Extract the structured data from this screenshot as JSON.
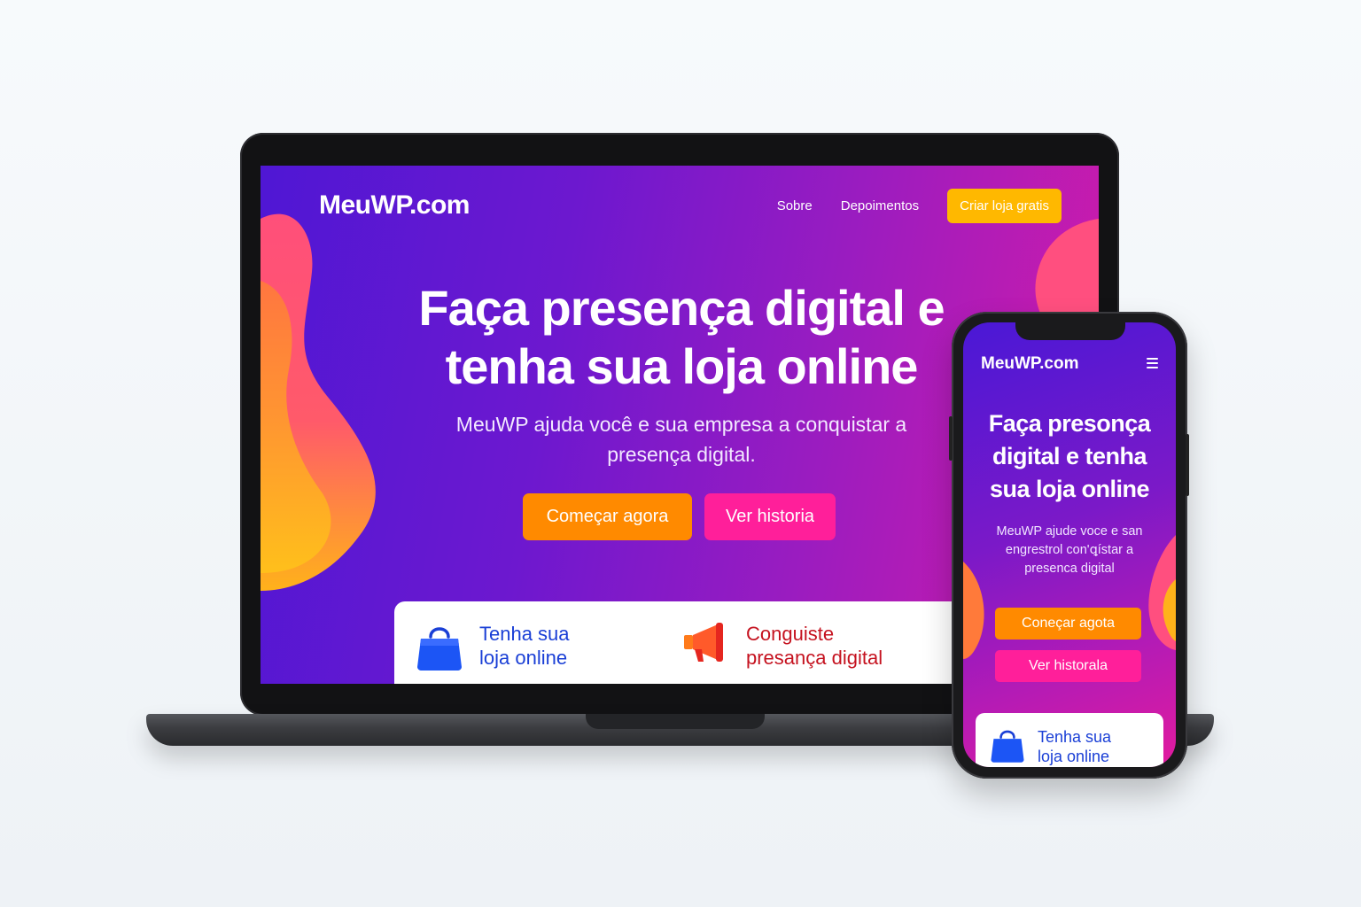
{
  "laptop": {
    "logo": "MeuWP.com",
    "nav": {
      "about": "Sobre",
      "testimonials": "Depoimentos",
      "cta": "Criar loja gratis"
    },
    "hero": {
      "title": "Faça presença digital e tenha sua loja online",
      "subtitle": "MeuWP ajuda você e sua empresa a conquistar a presença digital.",
      "primary_button": "Começar agora",
      "secondary_button": "Ver historia"
    },
    "features": [
      {
        "icon": "shopping-bag-icon",
        "text": "Tenha sua loja online"
      },
      {
        "icon": "megaphone-icon",
        "text": "Conguiste presança digital"
      }
    ]
  },
  "phone": {
    "logo": "MeuWP.com",
    "menu_icon": "hamburger-menu-icon",
    "hero": {
      "title": "Faça presonça digital e tenha sua loja online",
      "subtitle": "MeuWP ajude voce e san engrestrol con'ꝗístar a presenca digital",
      "primary_button": "Coneçar agota",
      "secondary_button": "Ver historala"
    },
    "features": [
      {
        "icon": "shopping-bag-icon",
        "text": "Tenha sua loja online"
      }
    ]
  },
  "colors": {
    "gradient_start": "#4f17d4",
    "gradient_end": "#d41ba8",
    "cta_yellow": "#ffb800",
    "button_orange": "#ff8a00",
    "button_pink": "#ff1f9a",
    "feature_blue": "#1a3fd6",
    "feature_red": "#c5121f"
  }
}
